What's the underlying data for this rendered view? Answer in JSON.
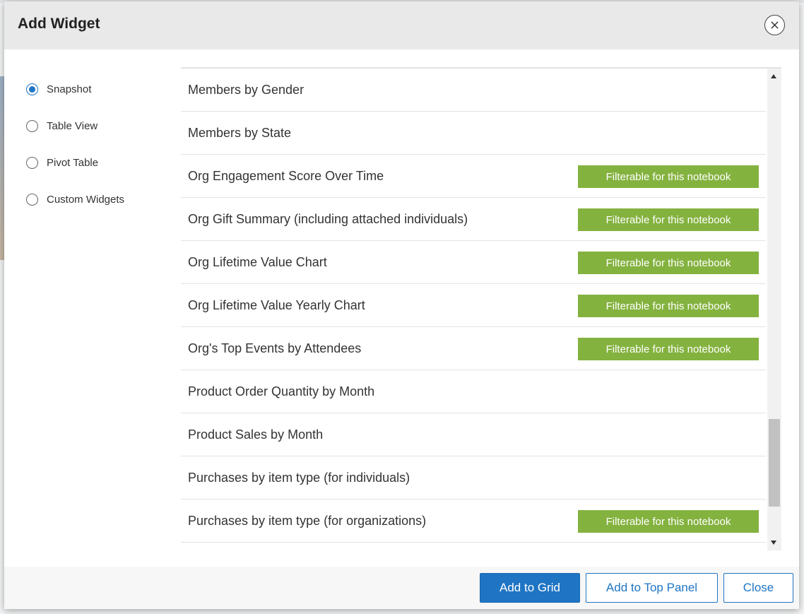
{
  "dialog": {
    "title": "Add Widget",
    "close_icon": "close-icon"
  },
  "options": [
    {
      "label": "Snapshot",
      "checked": true
    },
    {
      "label": "Table View",
      "checked": false
    },
    {
      "label": "Pivot Table",
      "checked": false
    },
    {
      "label": "Custom Widgets",
      "checked": false
    }
  ],
  "widgets": [
    {
      "label": "Members by Gender",
      "filterable": false
    },
    {
      "label": "Members by State",
      "filterable": false
    },
    {
      "label": "Org Engagement Score Over Time",
      "filterable": true
    },
    {
      "label": "Org Gift Summary (including attached individuals)",
      "filterable": true
    },
    {
      "label": "Org Lifetime Value Chart",
      "filterable": true
    },
    {
      "label": "Org Lifetime Value Yearly Chart",
      "filterable": true
    },
    {
      "label": "Org's Top Events by Attendees",
      "filterable": true
    },
    {
      "label": "Product Order Quantity by Month",
      "filterable": false
    },
    {
      "label": "Product Sales by Month",
      "filterable": false
    },
    {
      "label": "Purchases by item type (for individuals)",
      "filterable": false
    },
    {
      "label": "Purchases by item type (for organizations)",
      "filterable": true
    }
  ],
  "filter_badge_label": "Filterable for this notebook",
  "footer": {
    "add_to_grid": "Add to Grid",
    "add_to_top_panel": "Add to Top Panel",
    "close": "Close"
  },
  "colors": {
    "primary": "#1f75c4",
    "badge": "#84b23f",
    "header_bg": "#e9e9e9"
  }
}
